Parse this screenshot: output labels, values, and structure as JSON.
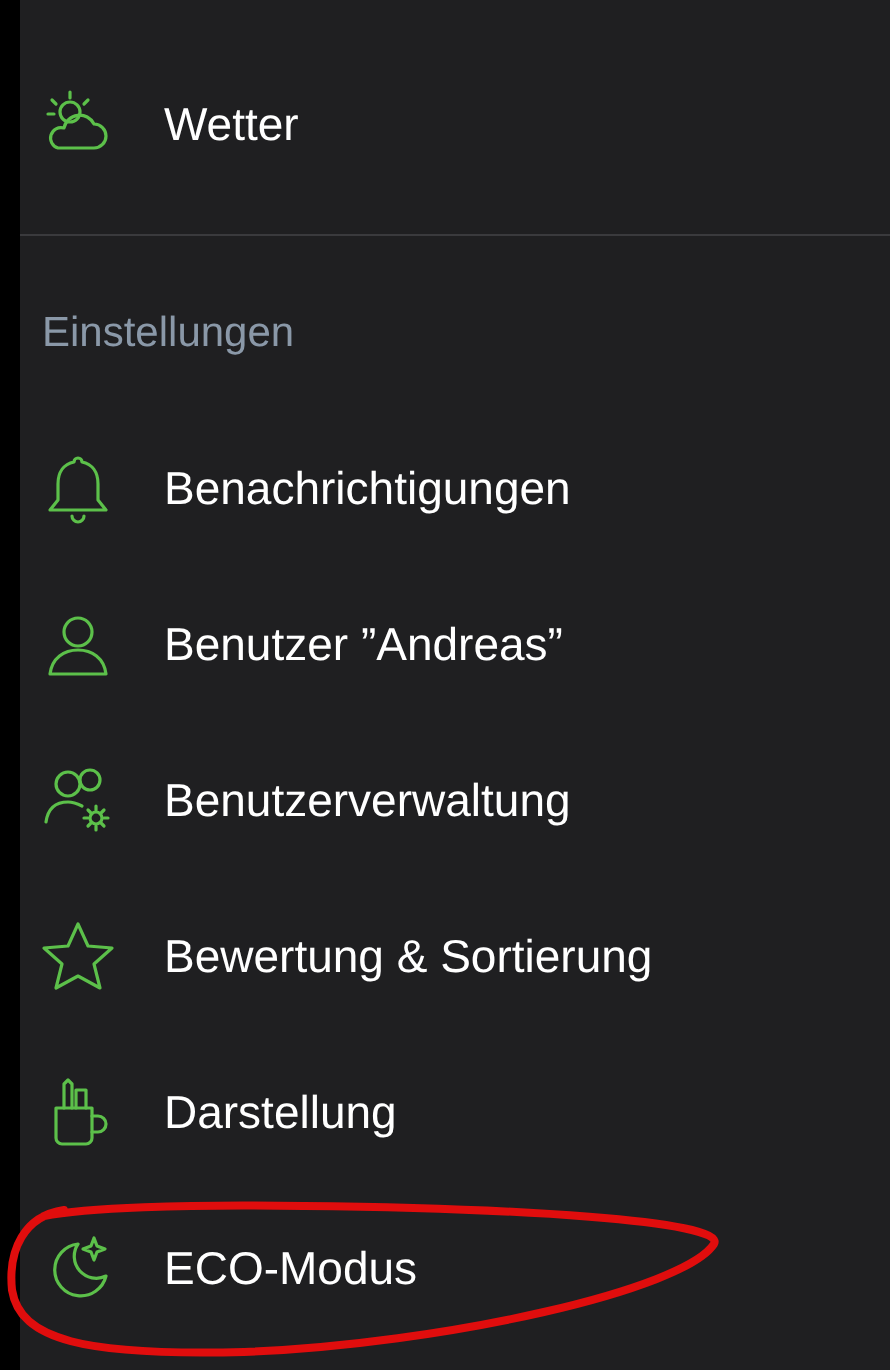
{
  "top_items": [
    {
      "label": "Wetter",
      "annotated": false
    }
  ],
  "section": {
    "title": "Einstellungen",
    "items": [
      {
        "label": "Benachrichtigungen",
        "annotated": false
      },
      {
        "label": "Benutzer ”Andreas”",
        "annotated": false
      },
      {
        "label": "Benutzerverwaltung",
        "annotated": false
      },
      {
        "label": "Bewertung & Sortierung",
        "annotated": false
      },
      {
        "label": "Darstellung",
        "annotated": false
      },
      {
        "label": "ECO-Modus",
        "annotated": true
      }
    ]
  }
}
